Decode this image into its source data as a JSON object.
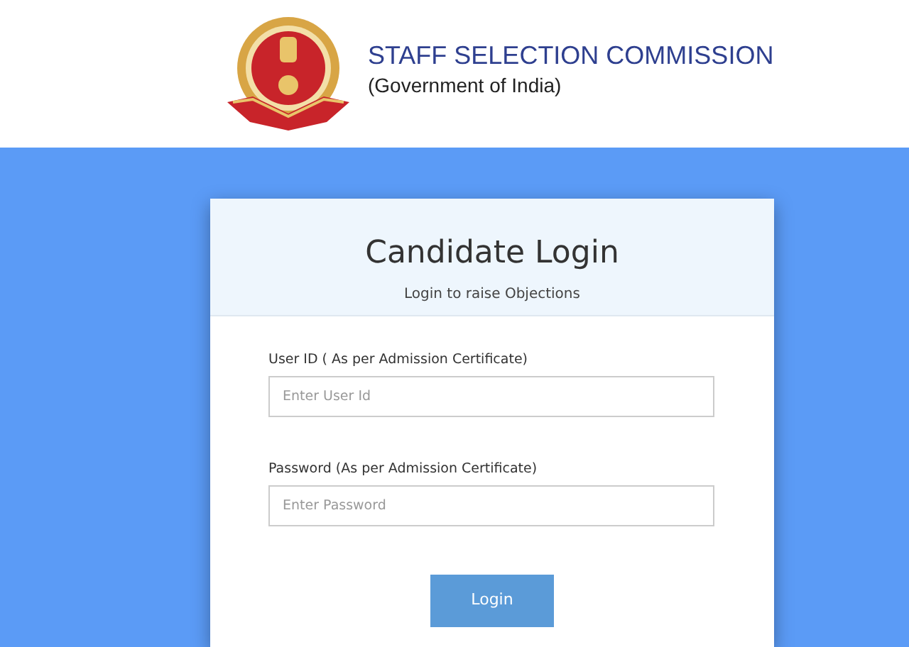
{
  "header": {
    "title": "STAFF SELECTION COMMISSION",
    "subtitle": "(Government of India)"
  },
  "login": {
    "title": "Candidate Login",
    "subtitle": "Login to raise Objections",
    "fields": [
      {
        "label": "User ID ( As per Admission Certificate)",
        "placeholder": "Enter User Id"
      },
      {
        "label": "Password (As per Admission Certificate)",
        "placeholder": "Enter Password"
      }
    ],
    "button": "Login"
  }
}
